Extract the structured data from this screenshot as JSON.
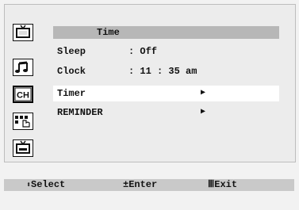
{
  "menu": {
    "title": "Time",
    "rows": [
      {
        "label": "Sleep",
        "value": ": Off",
        "arrow": ""
      },
      {
        "label": "Clock",
        "value": ": 11 : 35 am",
        "arrow": ""
      },
      {
        "label": "Timer",
        "value": "",
        "arrow": "▶"
      },
      {
        "label": "REMINDER",
        "value": "",
        "arrow": "▶"
      }
    ],
    "selected_index": 2
  },
  "side_icons": [
    {
      "name": "picture-icon"
    },
    {
      "name": "sound-icon"
    },
    {
      "name": "channel-icon",
      "text": "CH"
    },
    {
      "name": "function-icon"
    },
    {
      "name": "input-icon"
    }
  ],
  "footer": {
    "select_icon": "⬍",
    "select_label": "Select",
    "enter_icon": "±",
    "enter_label": "Enter",
    "exit_icon": "Ⅲ",
    "exit_label": "Exit"
  },
  "colors": {
    "header_bar": "#b7b7b7",
    "selected_row": "#ffffff",
    "footer_bar": "#c9c9c9",
    "screen_bg": "#ececec"
  }
}
